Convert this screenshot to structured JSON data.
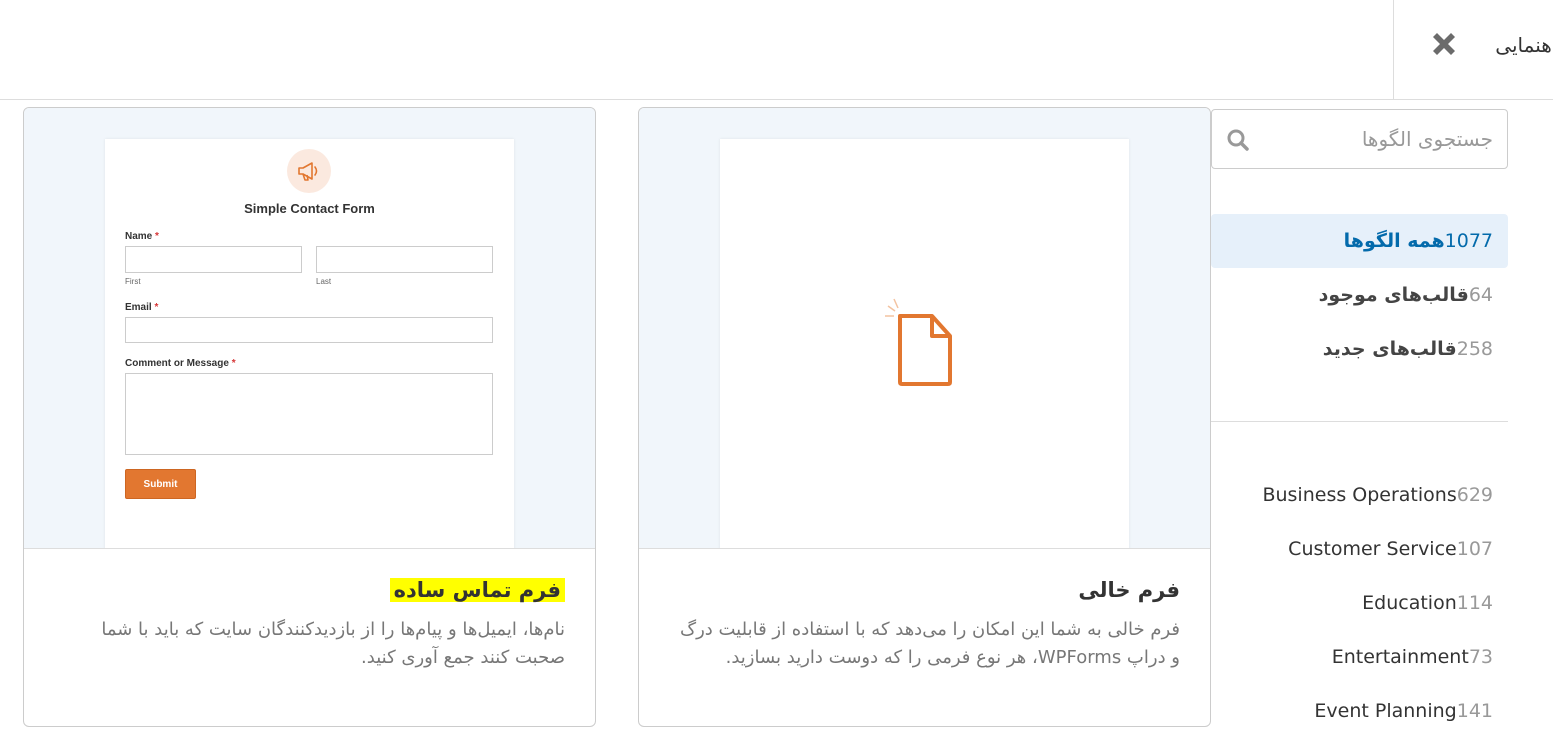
{
  "header": {
    "guide_label": "راهنمایی",
    "close_icon": "close-icon"
  },
  "search": {
    "placeholder": "جستجوی الگوها",
    "icon": "search-icon"
  },
  "categories_main": [
    {
      "label": "همه الگوها",
      "count": "1077",
      "active": true
    },
    {
      "label": "قالب‌های موجود",
      "count": "64",
      "active": false
    },
    {
      "label": "قالب‌های جدید",
      "count": "258",
      "active": false
    }
  ],
  "categories": [
    {
      "label": "Business Operations",
      "count": "629"
    },
    {
      "label": "Customer Service",
      "count": "107"
    },
    {
      "label": "Education",
      "count": "114"
    },
    {
      "label": "Entertainment",
      "count": "73"
    },
    {
      "label": "Event Planning",
      "count": "141"
    }
  ],
  "templates": [
    {
      "title": "فرم خالی",
      "description": "فرم خالی به شما این امکان را می‌دهد که با استفاده از قابلیت درگ و دراپ WPForms، هر نوع فرمی را که دوست دارید بسازید.",
      "preview_icon": "blank-document-icon"
    },
    {
      "title": "فرم تماس ساده",
      "description": "نام‌ها، ایمیل‌ها و پیام‌ها را از بازدیدکنندگان سایت که باید با شما صحبت کنند جمع آوری کنید.",
      "preview": {
        "logo_icon": "megaphone-icon",
        "form_title": "Simple Contact Form",
        "name_label": "Name",
        "first_label": "First",
        "last_label": "Last",
        "email_label": "Email",
        "comment_label": "Comment or Message",
        "required_mark": "*",
        "submit_label": "Submit"
      }
    }
  ],
  "colors": {
    "accent": "#036aab",
    "active_bg": "#e6f0fa",
    "orange": "#e27730",
    "highlight": "#ffff00"
  }
}
